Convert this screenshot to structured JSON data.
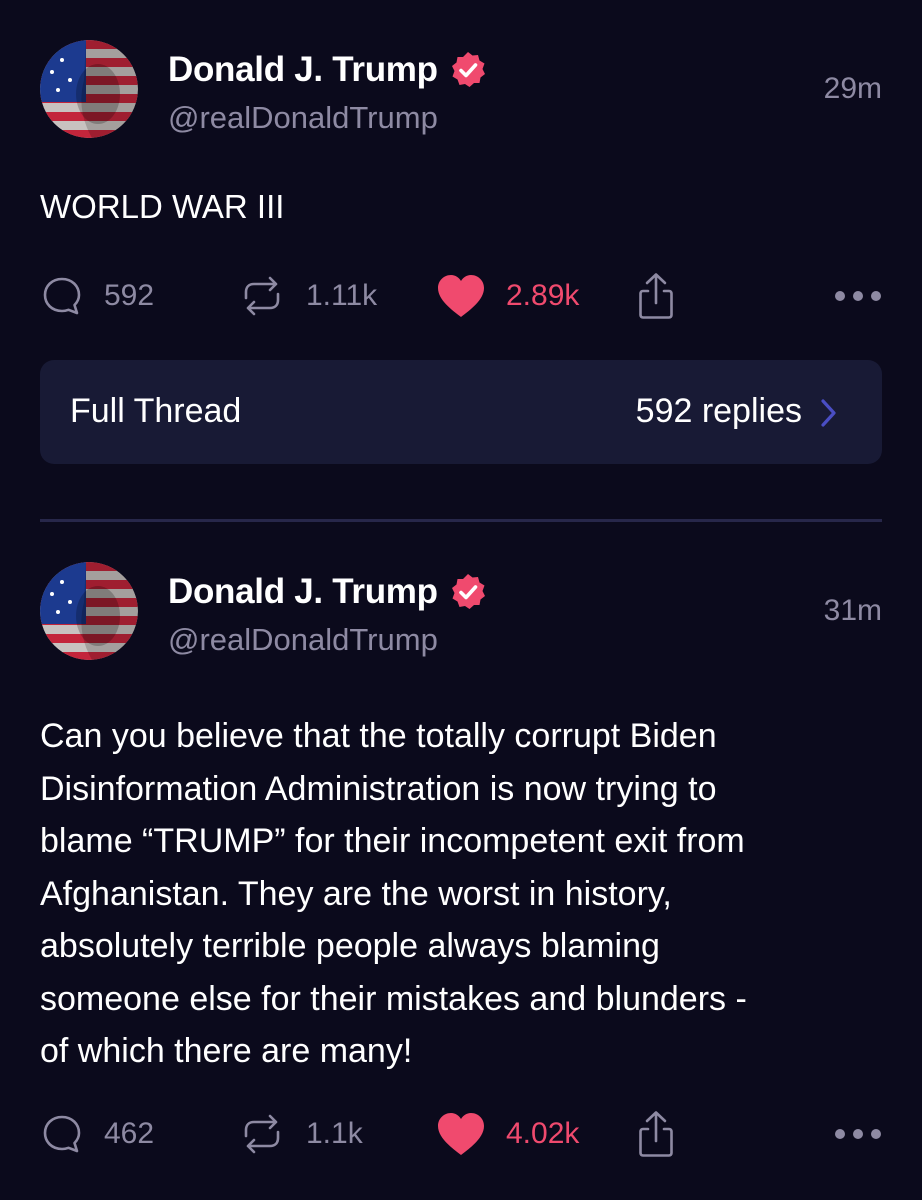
{
  "posts": [
    {
      "author": {
        "name": "Donald J. Trump",
        "handle": "@realDonaldTrump"
      },
      "time": "29m",
      "text": "WORLD WAR III",
      "stats": {
        "replies": "592",
        "retruths": "1.11k",
        "likes": "2.89k"
      },
      "thread": {
        "label": "Full Thread",
        "replies": "592 replies"
      }
    },
    {
      "author": {
        "name": "Donald J. Trump",
        "handle": "@realDonaldTrump"
      },
      "time": "31m",
      "text_lines": [
        "Can you believe that the totally corrupt Biden",
        "Disinformation Administration is now trying to",
        "blame “TRUMP” for their incompetent exit from",
        "Afghanistan. They are the worst in history,",
        "absolutely terrible people always blaming",
        "someone else for their mistakes and blunders -",
        "of which there are many!"
      ],
      "stats": {
        "replies": "462",
        "retruths": "1.1k",
        "likes": "4.02k"
      }
    }
  ],
  "icons": {
    "reply": "speech-bubble-icon",
    "retruth": "repost-arrows-icon",
    "like": "heart-icon",
    "share": "share-upload-icon",
    "more": "more-dots-icon",
    "verified": "verified-badge-icon",
    "chevron": "chevron-right-icon"
  },
  "colors": {
    "background": "#0b0a1c",
    "accent": "#f04a6e",
    "muted": "#8e8aa3",
    "thread_box": "#181a35",
    "chevron": "#4a4ec4"
  }
}
